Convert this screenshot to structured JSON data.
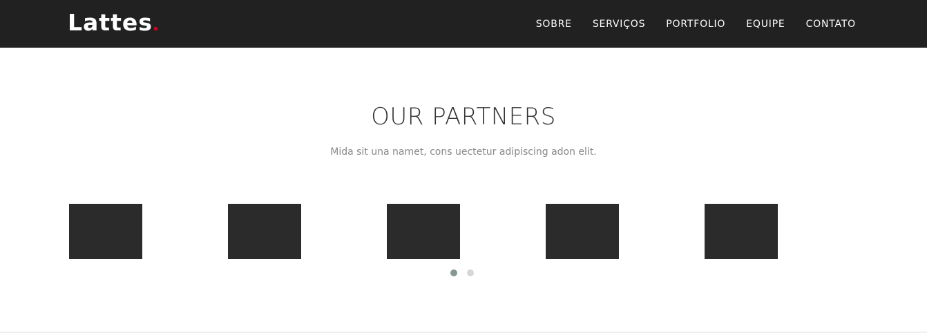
{
  "brand": {
    "name": "Lattes",
    "dot_color": "#d0021b"
  },
  "nav": {
    "items": [
      {
        "label": "SOBRE"
      },
      {
        "label": "SERVIÇOS"
      },
      {
        "label": "PORTFOLIO"
      },
      {
        "label": "EQUIPE"
      },
      {
        "label": "CONTATO"
      }
    ]
  },
  "partners_section": {
    "title": "OUR PARTNERS",
    "subtitle": "Mida sit una namet, cons uectetur adipiscing adon elit.",
    "logos_count_visible": 5,
    "pagination": {
      "pages": 2,
      "active_index": 0
    }
  },
  "colors": {
    "navbar_bg": "#212121",
    "logo_placeholder": "#2b2b2b",
    "dot_active": "#869791",
    "dot_inactive": "#d6d6d6"
  }
}
